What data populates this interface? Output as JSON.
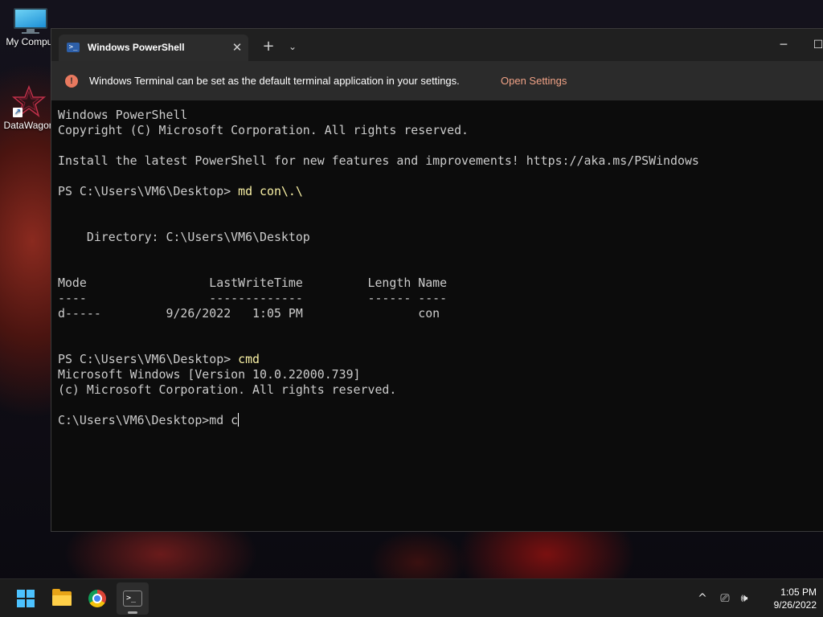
{
  "desktop": {
    "icons": [
      {
        "label": "My Comput",
        "icon": "monitor-icon"
      },
      {
        "label": "DataWagon",
        "icon": "datawagon-icon"
      }
    ]
  },
  "terminal": {
    "tab": {
      "title": "Windows PowerShell",
      "icon": "powershell-icon"
    },
    "infobar": {
      "message": "Windows Terminal can be set as the default terminal application in your settings.",
      "link": "Open Settings"
    },
    "lines": [
      {
        "text": "Windows PowerShell"
      },
      {
        "text": "Copyright (C) Microsoft Corporation. All rights reserved."
      },
      {
        "text": ""
      },
      {
        "text": "Install the latest PowerShell for new features and improvements! https://aka.ms/PSWindows"
      },
      {
        "text": ""
      },
      {
        "prompt": "PS C:\\Users\\VM6\\Desktop> ",
        "command": "md con\\.\\"
      },
      {
        "text": ""
      },
      {
        "text": ""
      },
      {
        "text": "    Directory: C:\\Users\\VM6\\Desktop"
      },
      {
        "text": ""
      },
      {
        "text": ""
      },
      {
        "text": "Mode                 LastWriteTime         Length Name"
      },
      {
        "text": "----                 -------------         ------ ----"
      },
      {
        "text": "d-----         9/26/2022   1:05 PM                con"
      },
      {
        "text": ""
      },
      {
        "text": ""
      },
      {
        "prompt": "PS C:\\Users\\VM6\\Desktop> ",
        "command": "cmd"
      },
      {
        "text": "Microsoft Windows [Version 10.0.22000.739]"
      },
      {
        "text": "(c) Microsoft Corporation. All rights reserved."
      },
      {
        "text": ""
      },
      {
        "text": "C:\\Users\\VM6\\Desktop>md c",
        "cursor": true
      }
    ]
  },
  "taskbar": {
    "apps": [
      "start-icon",
      "file-explorer-icon",
      "chrome-icon",
      "terminal-icon"
    ],
    "tray": {
      "chevron": "^",
      "network": "⎚",
      "volume": "🕪"
    },
    "clock": {
      "time": "1:05 PM",
      "date": "9/26/2022"
    }
  },
  "colors": {
    "accent": "#4cc2ff",
    "link": "#f0a286",
    "command": "#f9f1a5",
    "console_bg": "#0c0c0c"
  }
}
